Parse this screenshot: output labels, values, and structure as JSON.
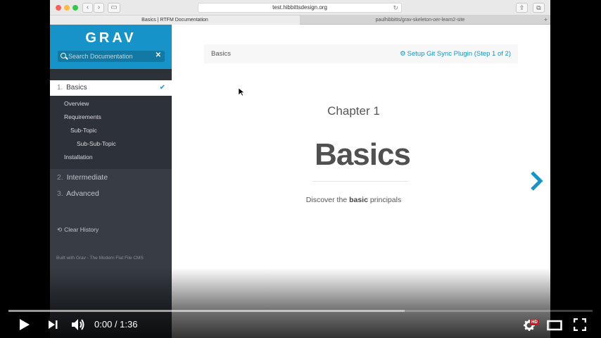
{
  "browser": {
    "url": "test.hibbittsdesign.org",
    "tabs": [
      {
        "label": "Basics | RTFM Documentation"
      },
      {
        "label": "paulhibbitts/grav-skeleton-oer-learn2-site"
      }
    ]
  },
  "sidebar": {
    "logo": "GRAV",
    "search_placeholder": "Search Documentation",
    "active_item": {
      "number": "1.",
      "label": "Basics"
    },
    "subitems": [
      "Overview",
      "Requirements",
      "Sub-Topic",
      "Sub-Sub-Topic",
      "Installation"
    ],
    "items": [
      {
        "number": "2.",
        "label": "Intermediate"
      },
      {
        "number": "3.",
        "label": "Advanced"
      }
    ],
    "clear_history": "Clear History",
    "built_with": "Built with Grav - The Modern Flat File CMS"
  },
  "main": {
    "breadcrumb": "Basics",
    "git_sync": "Setup Git Sync Plugin (Step 1 of 2)",
    "chapter": "Chapter 1",
    "title": "Basics",
    "subtitle_pre": "Discover the ",
    "subtitle_bold": "basic",
    "subtitle_post": " principals"
  },
  "player": {
    "time": "0:00 / 1:36",
    "hd_badge": "HD",
    "buffered_fraction": 0.678
  },
  "colors": {
    "accent": "#1694ca",
    "sidebar": "#383d45"
  }
}
